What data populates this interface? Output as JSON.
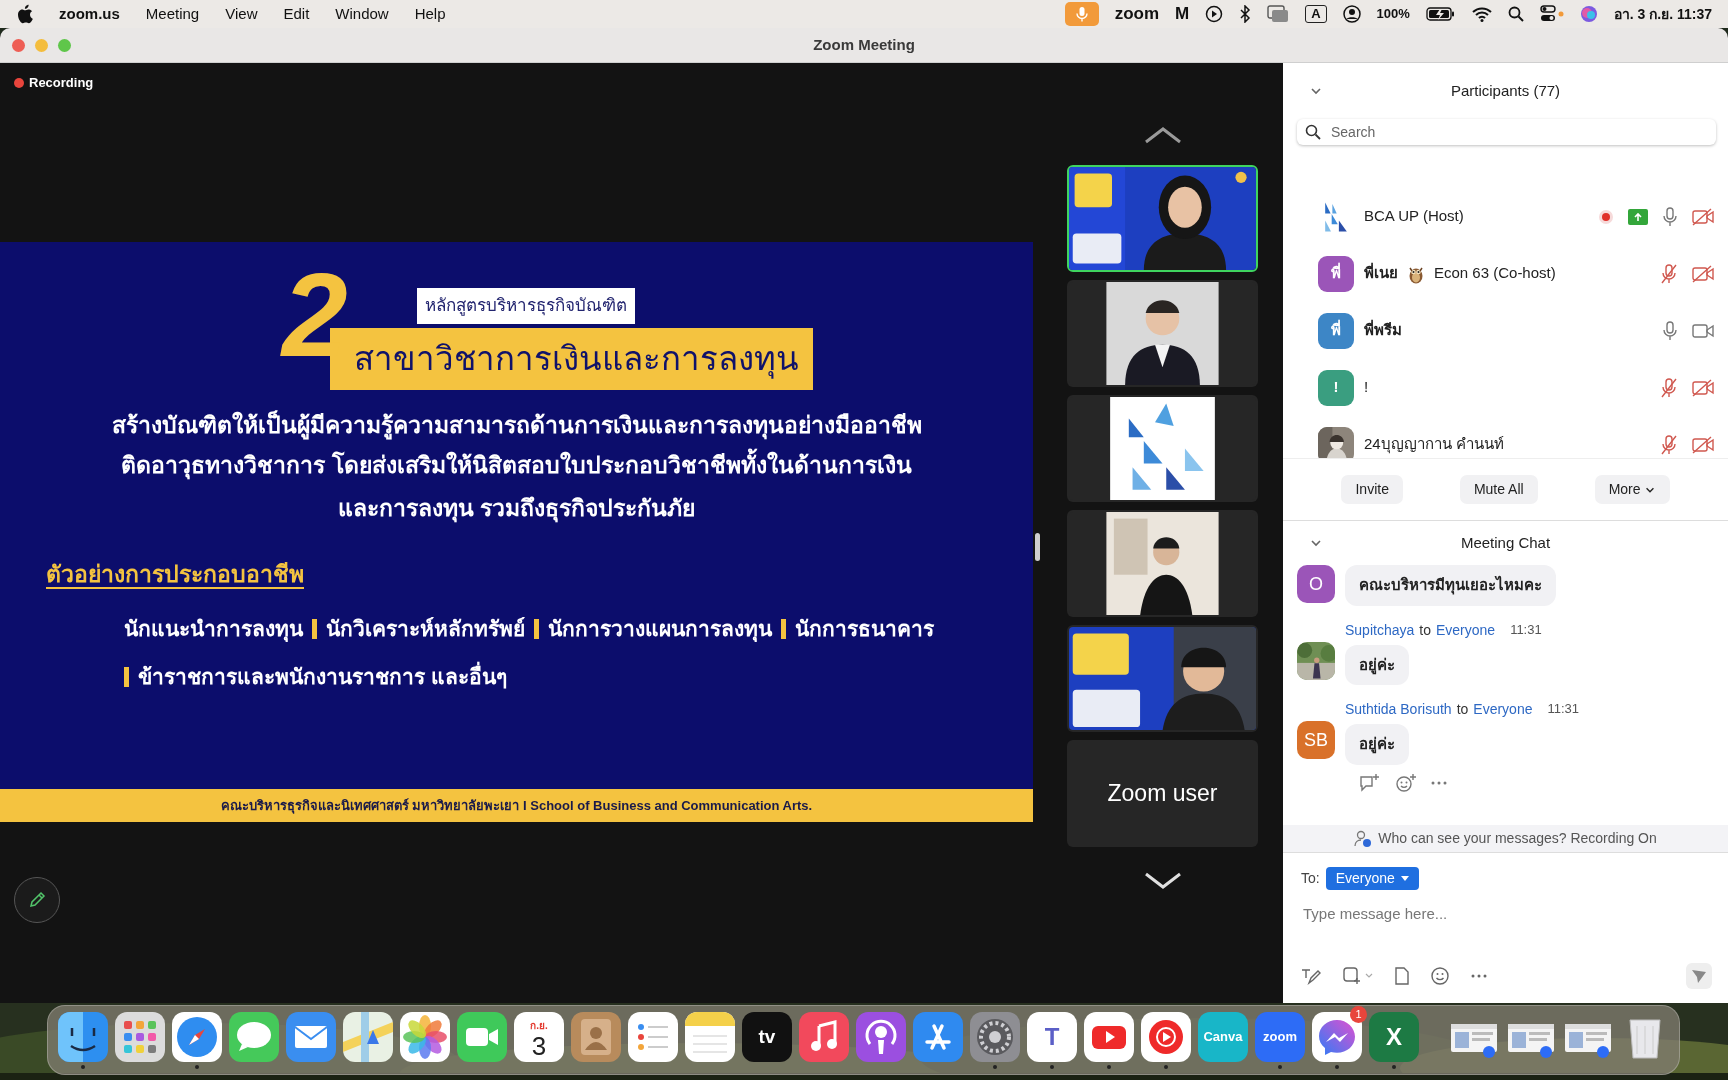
{
  "menu_bar": {
    "app": "zoom.us",
    "menus": [
      "Meeting",
      "View",
      "Edit",
      "Window",
      "Help"
    ],
    "status_items": [
      {
        "kind": "mic"
      },
      {
        "kind": "text",
        "label": "zoom"
      },
      {
        "kind": "logo-m",
        "label": "M"
      },
      {
        "kind": "play"
      },
      {
        "kind": "bluetooth"
      },
      {
        "kind": "mirror"
      },
      {
        "kind": "boxed",
        "label": "A"
      },
      {
        "kind": "user"
      },
      {
        "kind": "text",
        "label": "100%"
      },
      {
        "kind": "battery"
      },
      {
        "kind": "wifi"
      },
      {
        "kind": "search"
      },
      {
        "kind": "control"
      },
      {
        "kind": "siri"
      },
      {
        "kind": "text",
        "label": "อา. 3 ก.ย.  11:37"
      }
    ]
  },
  "window": {
    "title": "Zoom Meeting"
  },
  "recording": {
    "label": "Recording"
  },
  "slide": {
    "number": "2",
    "subtitle": "หลักสูตรบริหารธุรกิจบัณฑิต",
    "major": "สาขาวิชาการเงินและการลงทุน",
    "lines": [
      "สร้างบัณฑิตให้เป็นผู้มีความรู้ความสามารถ**ด้านการเงินและการลงทุนอย่างมืออาชีพ**",
      "ติดอาวุธทางวิชาการ โดยส่งเสริมให้นิสิตสอบใบประกอบวิชาชีพทั้งในด้านการเงิน",
      "และการลงทุน รวมถึงธุรกิจประกันภัย"
    ],
    "careers_heading": "ตัวอย่างการประกอบอาชีพ",
    "careers": [
      "นักแนะนำการลงทุน",
      "นักวิเคราะห์หลักทรัพย์",
      "นักการวางแผนการลงทุน",
      "นักการธนาคาร",
      "ข้าราชการและพนักงานราชการ และอื่นๆ"
    ],
    "footer": "คณะบริหารธุรกิจและนิเทศศาสตร์ มหาวิทยาลัยพะเยา I School of Business and Communication Arts."
  },
  "video_tiles": [
    {
      "kind": "picture",
      "active": true
    },
    {
      "kind": "picture",
      "active": false
    },
    {
      "kind": "picture",
      "active": false
    },
    {
      "kind": "picture",
      "active": false
    },
    {
      "kind": "picture",
      "active": false
    },
    {
      "kind": "name",
      "name": "Zoom user",
      "active": false
    }
  ],
  "participants": {
    "title": "Participants (77)",
    "search_placeholder": "Search",
    "items": [
      {
        "name": "BCA UP (Host)",
        "avatar": {
          "kind": "picture"
        },
        "recording": true,
        "sharing": true,
        "muted": false,
        "video_on": false
      },
      {
        "name": "พี่เนย",
        "name_suffix": "Econ 63 (Co-host)",
        "avatar": {
          "kind": "initial",
          "text": "พี่",
          "color": "#9b55b8"
        },
        "recording": false,
        "sharing": false,
        "muted": true,
        "video_on": false
      },
      {
        "name": "พี่พรีม",
        "avatar": {
          "kind": "initial",
          "text": "พี่",
          "color": "#3d86c6"
        },
        "recording": false,
        "sharing": false,
        "muted": false,
        "video_on": true
      },
      {
        "name": "!",
        "avatar": {
          "kind": "initial",
          "text": "!",
          "color": "#3a9e80"
        },
        "recording": false,
        "sharing": false,
        "muted": true,
        "video_on": false
      },
      {
        "name": "24บุญญากาน คำนนท์",
        "avatar": {
          "kind": "picture"
        },
        "recording": false,
        "sharing": false,
        "muted": true,
        "video_on": false
      }
    ],
    "buttons": [
      {
        "label": "Invite",
        "dropdown": false
      },
      {
        "label": "Mute All",
        "dropdown": false
      },
      {
        "label": "More",
        "dropdown": true
      }
    ]
  },
  "chat": {
    "title": "Meeting Chat",
    "messages": [
      {
        "avatar": {
          "kind": "initial",
          "text": "O",
          "color": "#9b55b8"
        },
        "text": "คณะบริหารมีทุนเยอะไหมคะ"
      },
      {
        "sender": "Supitchaya",
        "connector": "to",
        "recipient": "Everyone",
        "time": "11:31",
        "avatar": {
          "kind": "picture"
        },
        "text": "อยู่ค่ะ"
      },
      {
        "sender": "Suthtida Borisuth",
        "connector": "to",
        "recipient": "Everyone",
        "time": "11:31",
        "avatar": {
          "kind": "initial",
          "text": "SB",
          "color": "#d9712a"
        },
        "text": "อยู่ค่ะ"
      }
    ],
    "notice": "Who can see your messages? Recording On",
    "to_label": "To:",
    "recipient": "Everyone",
    "placeholder": "Type message here..."
  },
  "dock": {
    "apps": [
      {
        "kind": "finder",
        "running": true
      },
      {
        "kind": "launchpad",
        "running": false
      },
      {
        "kind": "safari",
        "running": true
      },
      {
        "kind": "messages",
        "running": false
      },
      {
        "kind": "mail",
        "running": false
      },
      {
        "kind": "maps",
        "running": false
      },
      {
        "kind": "photos",
        "running": false
      },
      {
        "kind": "facetime",
        "running": false
      },
      {
        "kind": "calendar",
        "month": "ก.ย.",
        "day": "3",
        "running": false
      },
      {
        "kind": "contacts",
        "running": false
      },
      {
        "kind": "reminders",
        "running": false
      },
      {
        "kind": "notes",
        "running": false
      },
      {
        "kind": "tv",
        "label": "tv",
        "running": false
      },
      {
        "kind": "music",
        "running": false
      },
      {
        "kind": "podcasts",
        "running": false
      },
      {
        "kind": "appstore",
        "running": false
      },
      {
        "kind": "settings",
        "running": true
      },
      {
        "kind": "teams",
        "label": "T",
        "running": true
      },
      {
        "kind": "youtube",
        "running": true
      },
      {
        "kind": "ytmusic",
        "running": true
      },
      {
        "kind": "canva",
        "label": "Canva",
        "running": false
      },
      {
        "kind": "zoom",
        "label": "zoom",
        "running": true
      },
      {
        "kind": "messenger",
        "badge": "1",
        "running": true
      },
      {
        "kind": "excel",
        "label": "X",
        "running": true
      }
    ],
    "windows": [
      {
        "kind": "window"
      },
      {
        "kind": "window"
      },
      {
        "kind": "window"
      }
    ]
  }
}
